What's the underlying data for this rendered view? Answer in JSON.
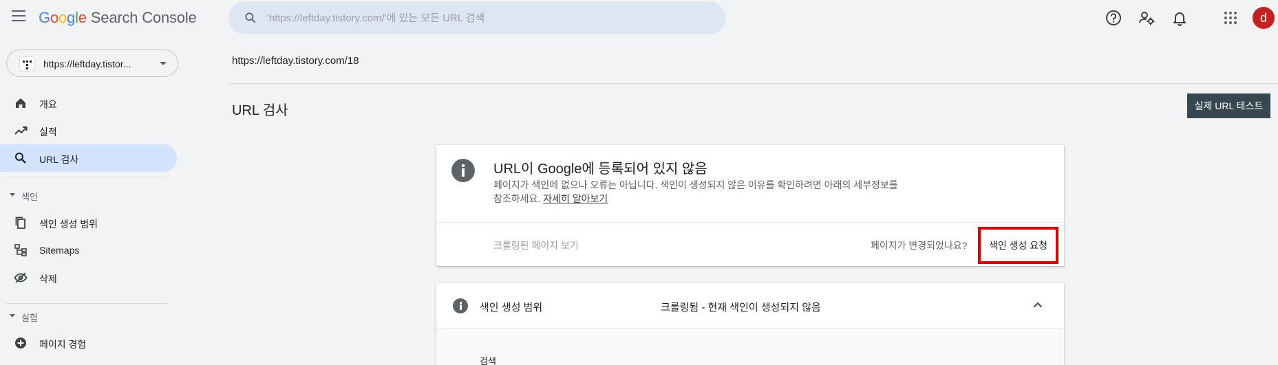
{
  "app": {
    "brand_letters": [
      "G",
      "o",
      "o",
      "g",
      "l",
      "e"
    ],
    "product": "Search Console"
  },
  "search": {
    "placeholder": "'https://leftday.tistory.com/'에 있는 모든 URL 검색"
  },
  "header_icons": [
    "help-icon",
    "manage-users-icon",
    "notifications-icon",
    "apps-grid-icon"
  ],
  "user": {
    "avatar_letter": "d",
    "avatar_color": "#c5221f"
  },
  "property": {
    "label": "https://leftday.tistor..."
  },
  "sidebar": {
    "items": [
      {
        "label": "개요",
        "icon": "home-icon"
      },
      {
        "label": "실적",
        "icon": "trending-icon"
      },
      {
        "label": "URL 검사",
        "icon": "search-icon",
        "active": true
      }
    ],
    "sections": [
      {
        "label": "색인",
        "items": [
          {
            "label": "색인 생성 범위",
            "icon": "pages-icon"
          },
          {
            "label": "Sitemaps",
            "icon": "sitemap-icon"
          },
          {
            "label": "삭제",
            "icon": "eye-off-icon"
          }
        ]
      },
      {
        "label": "실험",
        "items": [
          {
            "label": "페이지 경험",
            "icon": "add-circle-icon"
          }
        ]
      }
    ]
  },
  "main": {
    "inspected_url": "https://leftday.tistory.com/18",
    "title": "URL 검사",
    "live_test_button": "실제 URL 테스트"
  },
  "status_card": {
    "title": "URL이 Google에 등록되어 있지 않음",
    "description": "페이지가 색인에 없으나 오류는 아닙니다. 색인이 생성되지 않은 이유를 확인하려면 아래의 세부정보를 참조하세요.",
    "learn_more": "자세히 알아보기",
    "view_crawled": "크롤링된 페이지 보기",
    "page_changed": "페이지가 변경되었나요?",
    "request_indexing": "색인 생성 요청",
    "highlight_color": "#e00000"
  },
  "coverage_panel": {
    "label": "색인 생성 범위",
    "status": "크롤링됨 - 현재 색인이 생성되지 않음",
    "sub_label": "검색"
  }
}
